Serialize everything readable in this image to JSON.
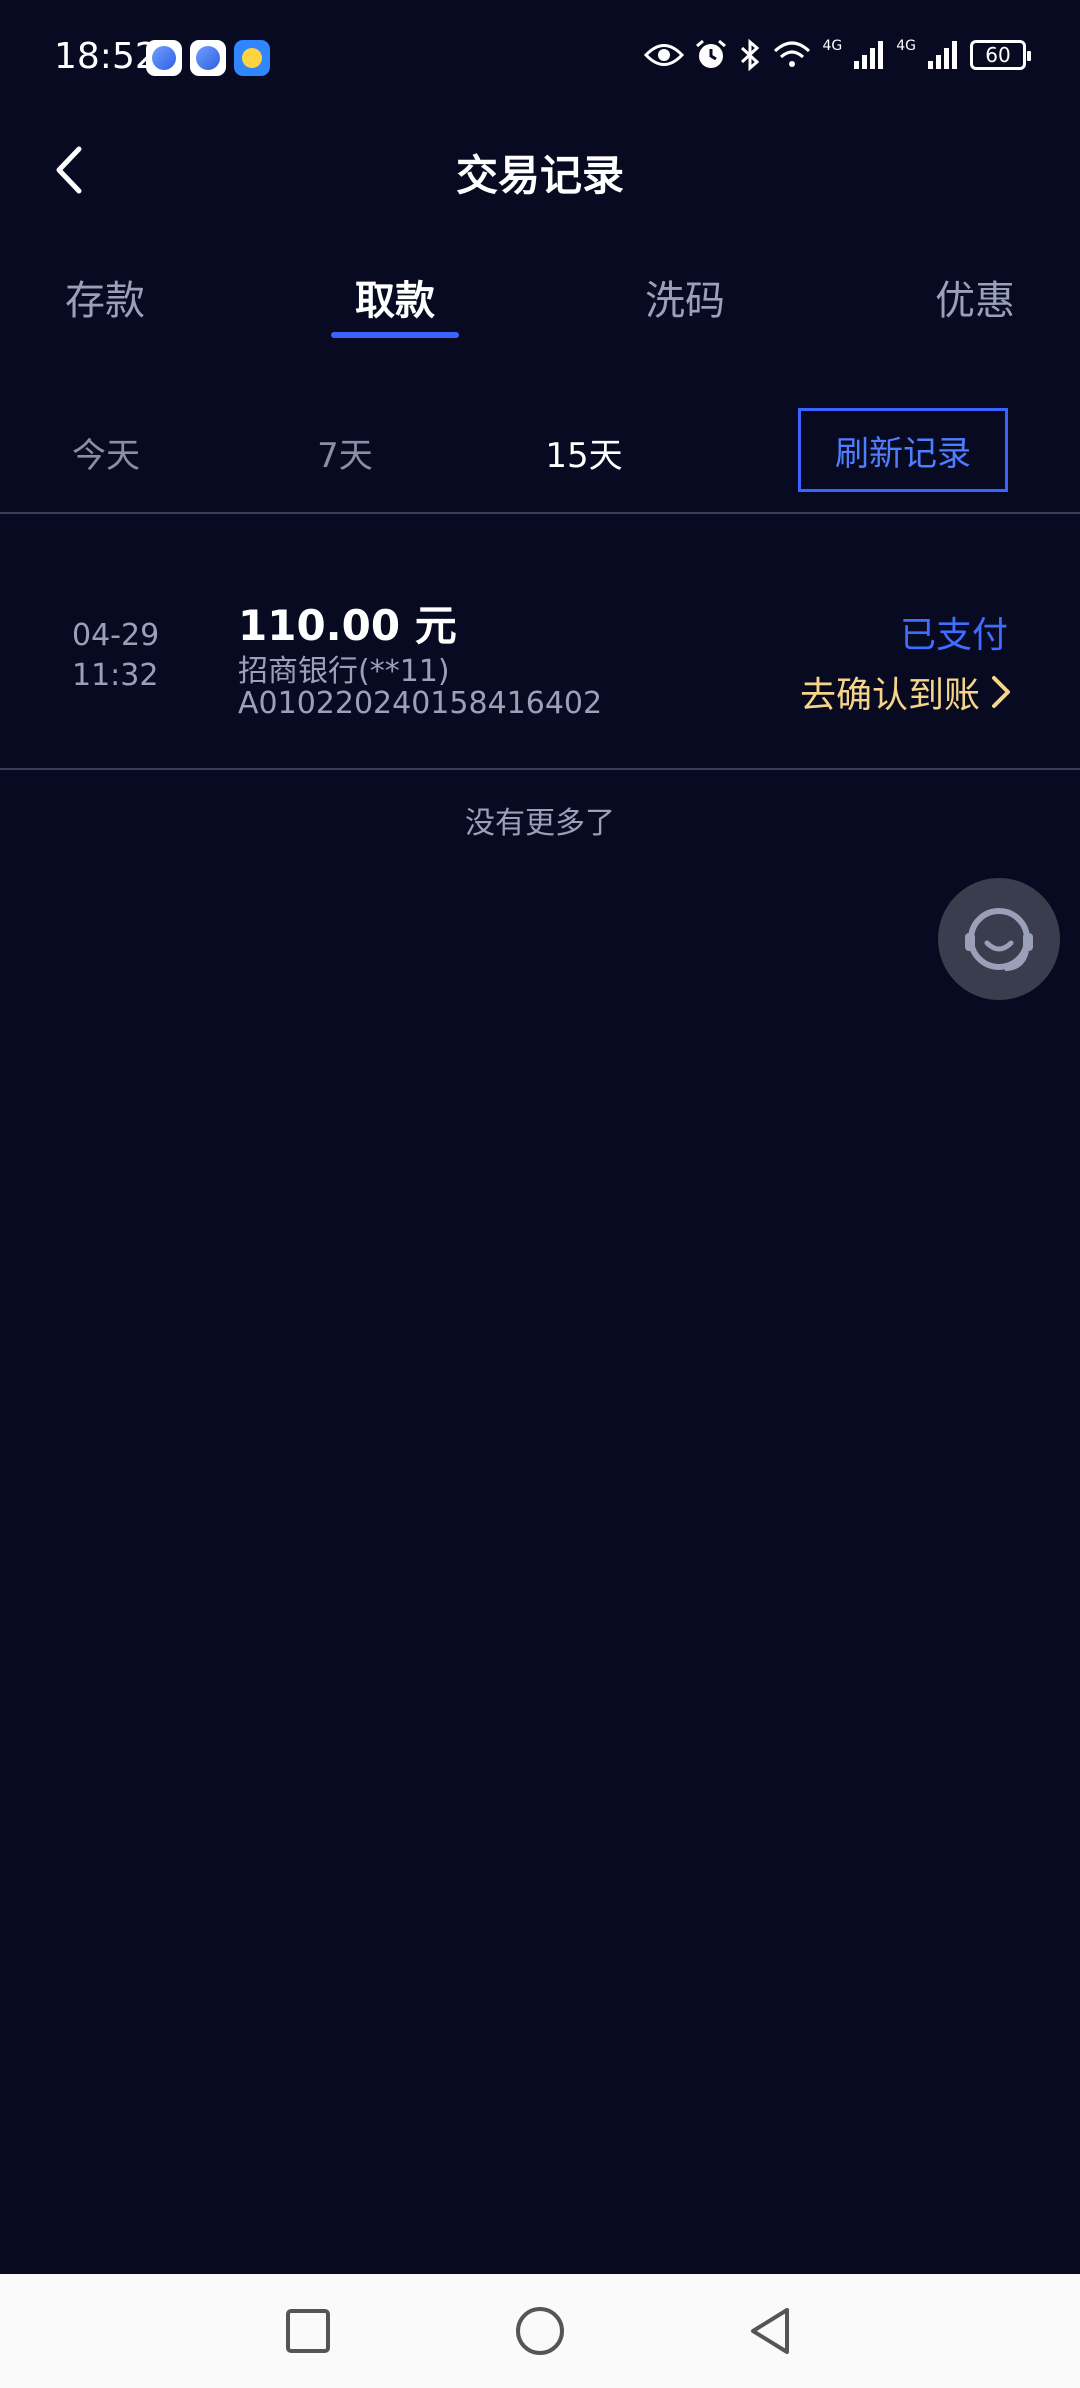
{
  "status_bar": {
    "time": "18:52",
    "network_1": "4G",
    "network_2": "4G",
    "battery": "60"
  },
  "header": {
    "title": "交易记录"
  },
  "tabs": [
    {
      "label": "存款",
      "active": false
    },
    {
      "label": "取款",
      "active": true
    },
    {
      "label": "洗码",
      "active": false
    },
    {
      "label": "优惠",
      "active": false
    }
  ],
  "filters": {
    "options": [
      "今天",
      "7天",
      "15天"
    ],
    "selected": "15天",
    "refresh_label": "刷新记录"
  },
  "records": [
    {
      "date": "04-29",
      "time": "11:32",
      "amount": "110.00 元",
      "bank": "招商银行(**11)",
      "order_no": "A010220240158416402",
      "status": "已支付",
      "action": "去确认到账"
    }
  ],
  "footer_text": "没有更多了",
  "colors": {
    "background": "#080a22",
    "accent": "#3b63ff",
    "confirm": "#f6d58a",
    "muted": "#9aa0b8"
  }
}
